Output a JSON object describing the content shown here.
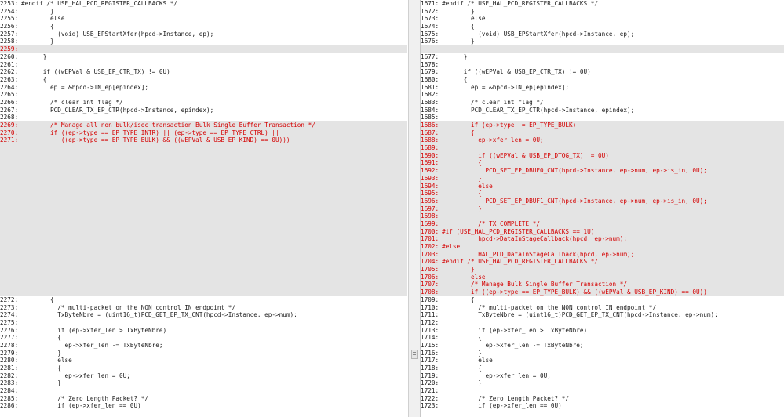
{
  "left": {
    "lines": [
      {
        "n": "2253:",
        "t": "#endif /* USE_HAL_PCD_REGISTER_CALLBACKS */",
        "k": "n"
      },
      {
        "n": "2254:",
        "t": "        }",
        "k": "n"
      },
      {
        "n": "2255:",
        "t": "        else",
        "k": "n"
      },
      {
        "n": "2256:",
        "t": "        {",
        "k": "n"
      },
      {
        "n": "2257:",
        "t": "          (void) USB_EPStartXfer(hpcd->Instance, ep);",
        "k": "n"
      },
      {
        "n": "2258:",
        "t": "        }",
        "k": "n"
      },
      {
        "n": "2259:",
        "t": "",
        "k": "c"
      },
      {
        "n": "2260:",
        "t": "      }",
        "k": "n"
      },
      {
        "n": "2261:",
        "t": "",
        "k": "n"
      },
      {
        "n": "2262:",
        "t": "      if ((wEPVal & USB_EP_CTR_TX) != 0U)",
        "k": "n"
      },
      {
        "n": "2263:",
        "t": "      {",
        "k": "n"
      },
      {
        "n": "2264:",
        "t": "        ep = &hpcd->IN_ep[epindex];",
        "k": "n"
      },
      {
        "n": "2265:",
        "t": "",
        "k": "n"
      },
      {
        "n": "2266:",
        "t": "        /* clear int flag */",
        "k": "n"
      },
      {
        "n": "2267:",
        "t": "        PCD_CLEAR_TX_EP_CTR(hpcd->Instance, epindex);",
        "k": "n"
      },
      {
        "n": "2268:",
        "t": "",
        "k": "n"
      },
      {
        "n": "2269:",
        "t": "        /* Manage all non bulk/isoc transaction Bulk Single Buffer Transaction */",
        "k": "c"
      },
      {
        "n": "2270:",
        "t": "        if ((ep->type == EP_TYPE_INTR) || (ep->type == EP_TYPE_CTRL) ||",
        "k": "c"
      },
      {
        "n": "2271:",
        "t": "           ((ep->type == EP_TYPE_BULK) && ((wEPVal & USB_EP_KIND) == 0U)))",
        "k": "c"
      },
      {
        "n": "",
        "t": "",
        "k": "p"
      },
      {
        "n": "",
        "t": "",
        "k": "p"
      },
      {
        "n": "",
        "t": "",
        "k": "p"
      },
      {
        "n": "",
        "t": "",
        "k": "p"
      },
      {
        "n": "",
        "t": "",
        "k": "p"
      },
      {
        "n": "",
        "t": "",
        "k": "p"
      },
      {
        "n": "",
        "t": "",
        "k": "p"
      },
      {
        "n": "",
        "t": "",
        "k": "p"
      },
      {
        "n": "",
        "t": "",
        "k": "p"
      },
      {
        "n": "",
        "t": "",
        "k": "p"
      },
      {
        "n": "",
        "t": "",
        "k": "p"
      },
      {
        "n": "",
        "t": "",
        "k": "p"
      },
      {
        "n": "",
        "t": "",
        "k": "p"
      },
      {
        "n": "",
        "t": "",
        "k": "p"
      },
      {
        "n": "",
        "t": "",
        "k": "p"
      },
      {
        "n": "",
        "t": "",
        "k": "p"
      },
      {
        "n": "",
        "t": "",
        "k": "p"
      },
      {
        "n": "",
        "t": "",
        "k": "p"
      },
      {
        "n": "",
        "t": "",
        "k": "p"
      },
      {
        "n": "",
        "t": "",
        "k": "p"
      },
      {
        "n": "2272:",
        "t": "        {",
        "k": "n"
      },
      {
        "n": "2273:",
        "t": "          /* multi-packet on the NON control IN endpoint */",
        "k": "n"
      },
      {
        "n": "2274:",
        "t": "          TxByteNbre = (uint16_t)PCD_GET_EP_TX_CNT(hpcd->Instance, ep->num);",
        "k": "n"
      },
      {
        "n": "2275:",
        "t": "",
        "k": "n"
      },
      {
        "n": "2276:",
        "t": "          if (ep->xfer_len > TxByteNbre)",
        "k": "n"
      },
      {
        "n": "2277:",
        "t": "          {",
        "k": "n"
      },
      {
        "n": "2278:",
        "t": "            ep->xfer_len -= TxByteNbre;",
        "k": "n"
      },
      {
        "n": "2279:",
        "t": "          }",
        "k": "n"
      },
      {
        "n": "2280:",
        "t": "          else",
        "k": "n"
      },
      {
        "n": "2281:",
        "t": "          {",
        "k": "n"
      },
      {
        "n": "2282:",
        "t": "            ep->xfer_len = 0U;",
        "k": "n"
      },
      {
        "n": "2283:",
        "t": "          }",
        "k": "n"
      },
      {
        "n": "2284:",
        "t": "",
        "k": "n"
      },
      {
        "n": "2285:",
        "t": "          /* Zero Length Packet? */",
        "k": "n"
      },
      {
        "n": "2286:",
        "t": "          if (ep->xfer_len == 0U)",
        "k": "n"
      }
    ]
  },
  "right": {
    "lines": [
      {
        "n": "1671:",
        "t": "#endif /* USE_HAL_PCD_REGISTER_CALLBACKS */",
        "k": "n"
      },
      {
        "n": "1672:",
        "t": "        }",
        "k": "n"
      },
      {
        "n": "1673:",
        "t": "        else",
        "k": "n"
      },
      {
        "n": "1674:",
        "t": "        {",
        "k": "n"
      },
      {
        "n": "1675:",
        "t": "          (void) USB_EPStartXfer(hpcd->Instance, ep);",
        "k": "n"
      },
      {
        "n": "1676:",
        "t": "        }",
        "k": "n"
      },
      {
        "n": "",
        "t": "",
        "k": "p"
      },
      {
        "n": "1677:",
        "t": "      }",
        "k": "n"
      },
      {
        "n": "1678:",
        "t": "",
        "k": "n"
      },
      {
        "n": "1679:",
        "t": "      if ((wEPVal & USB_EP_CTR_TX) != 0U)",
        "k": "n"
      },
      {
        "n": "1680:",
        "t": "      {",
        "k": "n"
      },
      {
        "n": "1681:",
        "t": "        ep = &hpcd->IN_ep[epindex];",
        "k": "n"
      },
      {
        "n": "1682:",
        "t": "",
        "k": "n"
      },
      {
        "n": "1683:",
        "t": "        /* clear int flag */",
        "k": "n"
      },
      {
        "n": "1684:",
        "t": "        PCD_CLEAR_TX_EP_CTR(hpcd->Instance, epindex);",
        "k": "n"
      },
      {
        "n": "1685:",
        "t": "",
        "k": "n"
      },
      {
        "n": "1686:",
        "t": "        if (ep->type != EP_TYPE_BULK)",
        "k": "c"
      },
      {
        "n": "1687:",
        "t": "        {",
        "k": "c"
      },
      {
        "n": "1688:",
        "t": "          ep->xfer_len = 0U;",
        "k": "c"
      },
      {
        "n": "1689:",
        "t": "",
        "k": "c"
      },
      {
        "n": "1690:",
        "t": "          if ((wEPVal & USB_EP_DTOG_TX) != 0U)",
        "k": "c"
      },
      {
        "n": "1691:",
        "t": "          {",
        "k": "c"
      },
      {
        "n": "1692:",
        "t": "            PCD_SET_EP_DBUF0_CNT(hpcd->Instance, ep->num, ep->is_in, 0U);",
        "k": "c"
      },
      {
        "n": "1693:",
        "t": "          }",
        "k": "c"
      },
      {
        "n": "1694:",
        "t": "          else",
        "k": "c"
      },
      {
        "n": "1695:",
        "t": "          {",
        "k": "c"
      },
      {
        "n": "1696:",
        "t": "            PCD_SET_EP_DBUF1_CNT(hpcd->Instance, ep->num, ep->is_in, 0U);",
        "k": "c"
      },
      {
        "n": "1697:",
        "t": "          }",
        "k": "c"
      },
      {
        "n": "1698:",
        "t": "",
        "k": "c"
      },
      {
        "n": "1699:",
        "t": "          /* TX COMPLETE */",
        "k": "c"
      },
      {
        "n": "1700:",
        "t": "#if (USE_HAL_PCD_REGISTER_CALLBACKS == 1U)",
        "k": "c"
      },
      {
        "n": "1701:",
        "t": "          hpcd->DataInStageCallback(hpcd, ep->num);",
        "k": "c"
      },
      {
        "n": "1702:",
        "t": "#else",
        "k": "c"
      },
      {
        "n": "1703:",
        "t": "          HAL_PCD_DataInStageCallback(hpcd, ep->num);",
        "k": "c"
      },
      {
        "n": "1704:",
        "t": "#endif /* USE_HAL_PCD_REGISTER_CALLBACKS */",
        "k": "c"
      },
      {
        "n": "1705:",
        "t": "        }",
        "k": "c"
      },
      {
        "n": "1706:",
        "t": "        else",
        "k": "c"
      },
      {
        "n": "1707:",
        "t": "        /* Manage Bulk Single Buffer Transaction */",
        "k": "c"
      },
      {
        "n": "1708:",
        "t": "        if ((ep->type == EP_TYPE_BULK) && ((wEPVal & USB_EP_KIND) == 0U))",
        "k": "c"
      },
      {
        "n": "1709:",
        "t": "        {",
        "k": "n"
      },
      {
        "n": "1710:",
        "t": "          /* multi-packet on the NON control IN endpoint */",
        "k": "n"
      },
      {
        "n": "1711:",
        "t": "          TxByteNbre = (uint16_t)PCD_GET_EP_TX_CNT(hpcd->Instance, ep->num);",
        "k": "n"
      },
      {
        "n": "1712:",
        "t": "",
        "k": "n"
      },
      {
        "n": "1713:",
        "t": "          if (ep->xfer_len > TxByteNbre)",
        "k": "n"
      },
      {
        "n": "1714:",
        "t": "          {",
        "k": "n"
      },
      {
        "n": "1715:",
        "t": "            ep->xfer_len -= TxByteNbre;",
        "k": "n"
      },
      {
        "n": "1716:",
        "t": "          }",
        "k": "n"
      },
      {
        "n": "1717:",
        "t": "          else",
        "k": "n"
      },
      {
        "n": "1718:",
        "t": "          {",
        "k": "n"
      },
      {
        "n": "1719:",
        "t": "            ep->xfer_len = 0U;",
        "k": "n"
      },
      {
        "n": "1720:",
        "t": "          }",
        "k": "n"
      },
      {
        "n": "1721:",
        "t": "",
        "k": "n"
      },
      {
        "n": "1722:",
        "t": "          /* Zero Length Packet? */",
        "k": "n"
      },
      {
        "n": "1723:",
        "t": "          if (ep->xfer_len == 0U)",
        "k": "n"
      }
    ]
  },
  "colors": {
    "changed_text": "#d40000",
    "changed_bg": "#e4e4e4",
    "normal_text": "#1a1a1a"
  }
}
